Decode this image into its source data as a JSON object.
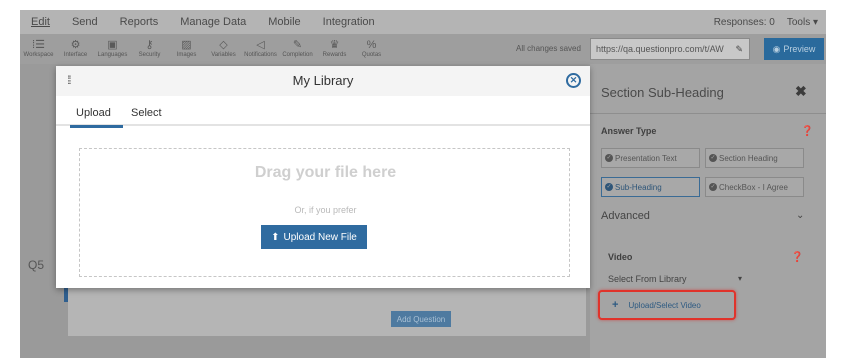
{
  "menu": {
    "items": [
      "Edit",
      "Send",
      "Reports",
      "Manage Data",
      "Mobile",
      "Integration"
    ],
    "responses": "Responses: 0",
    "tools": "Tools ▾"
  },
  "toolbar": {
    "tools": [
      {
        "label": "Workspace",
        "icon": "workspace-icon",
        "glyph": "⁞☰"
      },
      {
        "label": "Interface",
        "icon": "gear-icon",
        "glyph": "⚙"
      },
      {
        "label": "Languages",
        "icon": "languages-icon",
        "glyph": "▣"
      },
      {
        "label": "Security",
        "icon": "key-icon",
        "glyph": "⚷"
      },
      {
        "label": "Images",
        "icon": "image-icon",
        "glyph": "▨"
      },
      {
        "label": "Variables",
        "icon": "tag-icon",
        "glyph": "◇"
      },
      {
        "label": "Notifications",
        "icon": "megaphone-icon",
        "glyph": "◁"
      },
      {
        "label": "Completion",
        "icon": "pen-icon",
        "glyph": "✎"
      },
      {
        "label": "Rewards",
        "icon": "trophy-icon",
        "glyph": "♛"
      },
      {
        "label": "Quotas",
        "icon": "percent-icon",
        "glyph": "%"
      }
    ],
    "saved_status": "All changes saved",
    "url": "https://qa.questionpro.com/t/AW",
    "preview_label": "Preview"
  },
  "workspace": {
    "question_number": "Q5",
    "add_question_label": "Add Question"
  },
  "panel": {
    "title": "Section Sub-Heading",
    "answer_type_label": "Answer Type",
    "options": [
      {
        "label": "Presentation Text",
        "selected": false
      },
      {
        "label": "Section Heading",
        "selected": false
      },
      {
        "label": "Sub-Heading",
        "selected": true
      },
      {
        "label": "CheckBox - I Agree",
        "selected": false
      }
    ],
    "advanced_label": "Advanced",
    "video_label": "Video",
    "select_source": "Select From Library",
    "upload_video_label": "Upload/Select Video"
  },
  "modal": {
    "title": "My Library",
    "tabs": [
      "Upload",
      "Select"
    ],
    "active_tab": "Upload",
    "drop_title": "Drag your file here",
    "drop_sub": "Or, if you prefer",
    "upload_button": "Upload New File"
  },
  "colors": {
    "accent": "#2f6ba0",
    "highlight": "#e0332b",
    "overlay": "#9a9a9a"
  }
}
